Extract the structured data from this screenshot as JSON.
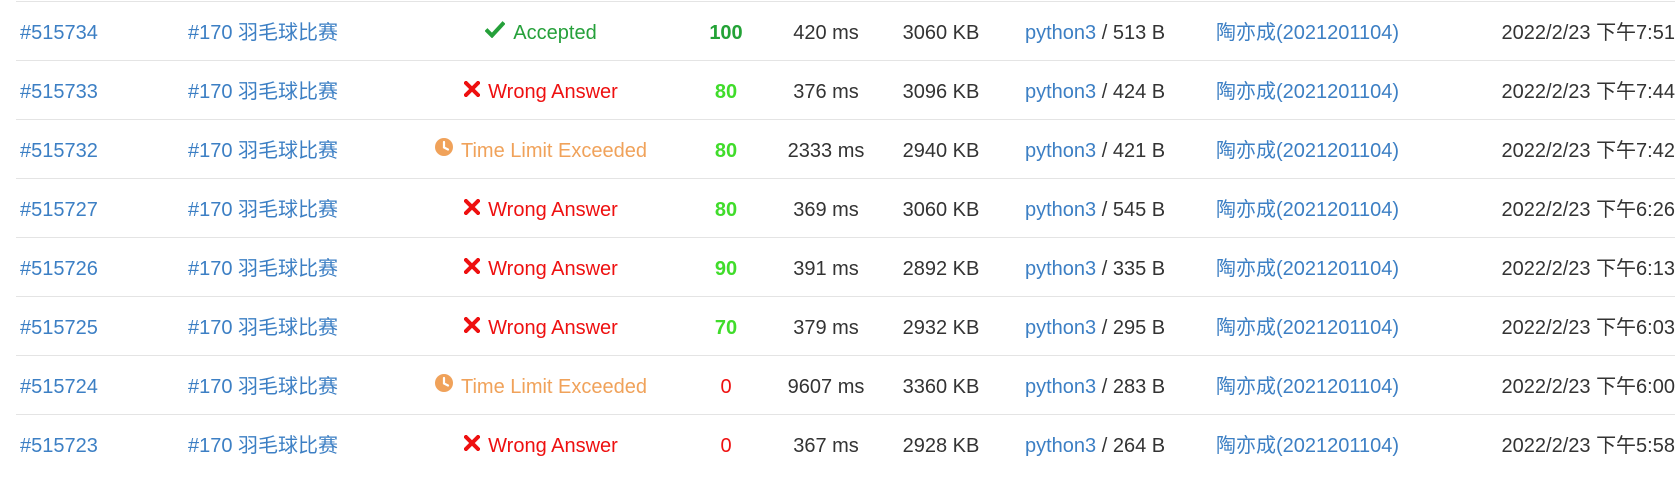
{
  "rows": [
    {
      "id": "#515734",
      "problem": "#170 羽毛球比赛",
      "status": "Accepted",
      "status_kind": "accepted",
      "status_icon": "check-icon",
      "score": "100",
      "score_color": "#23a236",
      "time": "420 ms",
      "memory": "3060 KB",
      "language": "python3",
      "code_size": " / 513 B",
      "user": "陶亦成(2021201104)",
      "submitted": "2022/2/23 下午7:51"
    },
    {
      "id": "#515733",
      "problem": "#170 羽毛球比赛",
      "status": "Wrong Answer",
      "status_kind": "wrong-answer",
      "status_icon": "cross-icon",
      "score": "80",
      "score_color": "#40dc2b",
      "time": "376 ms",
      "memory": "3096 KB",
      "language": "python3",
      "code_size": " / 424 B",
      "user": "陶亦成(2021201104)",
      "submitted": "2022/2/23 下午7:44"
    },
    {
      "id": "#515732",
      "problem": "#170 羽毛球比赛",
      "status": "Time Limit Exceeded",
      "status_kind": "time-limit-exceeded",
      "status_icon": "clock-icon",
      "score": "80",
      "score_color": "#40dc2b",
      "time": "2333 ms",
      "memory": "2940 KB",
      "language": "python3",
      "code_size": " / 421 B",
      "user": "陶亦成(2021201104)",
      "submitted": "2022/2/23 下午7:42"
    },
    {
      "id": "#515727",
      "problem": "#170 羽毛球比赛",
      "status": "Wrong Answer",
      "status_kind": "wrong-answer",
      "status_icon": "cross-icon",
      "score": "80",
      "score_color": "#40dc2b",
      "time": "369 ms",
      "memory": "3060 KB",
      "language": "python3",
      "code_size": " / 545 B",
      "user": "陶亦成(2021201104)",
      "submitted": "2022/2/23 下午6:26"
    },
    {
      "id": "#515726",
      "problem": "#170 羽毛球比赛",
      "status": "Wrong Answer",
      "status_kind": "wrong-answer",
      "status_icon": "cross-icon",
      "score": "90",
      "score_color": "#40dc2b",
      "time": "391 ms",
      "memory": "2892 KB",
      "language": "python3",
      "code_size": " / 335 B",
      "user": "陶亦成(2021201104)",
      "submitted": "2022/2/23 下午6:13"
    },
    {
      "id": "#515725",
      "problem": "#170 羽毛球比赛",
      "status": "Wrong Answer",
      "status_kind": "wrong-answer",
      "status_icon": "cross-icon",
      "score": "70",
      "score_color": "#40dc2b",
      "time": "379 ms",
      "memory": "2932 KB",
      "language": "python3",
      "code_size": " / 295 B",
      "user": "陶亦成(2021201104)",
      "submitted": "2022/2/23 下午6:03"
    },
    {
      "id": "#515724",
      "problem": "#170 羽毛球比赛",
      "status": "Time Limit Exceeded",
      "status_kind": "time-limit-exceeded",
      "status_icon": "clock-icon",
      "score": "0",
      "score_color": "#ee1010",
      "time": "9607 ms",
      "memory": "3360 KB",
      "language": "python3",
      "code_size": " / 283 B",
      "user": "陶亦成(2021201104)",
      "submitted": "2022/2/23 下午6:00"
    },
    {
      "id": "#515723",
      "problem": "#170 羽毛球比赛",
      "status": "Wrong Answer",
      "status_kind": "wrong-answer",
      "status_icon": "cross-icon",
      "score": "0",
      "score_color": "#ee1010",
      "time": "367 ms",
      "memory": "2928 KB",
      "language": "python3",
      "code_size": " / 264 B",
      "user": "陶亦成(2021201104)",
      "submitted": "2022/2/23 下午5:58"
    }
  ],
  "colors": {
    "link": "#3c7fc4",
    "accepted": "#25a03a",
    "wrong_answer": "#ee1010",
    "time_limit_exceeded": "#f0a25a",
    "row_divider": "#e4e4e4"
  }
}
